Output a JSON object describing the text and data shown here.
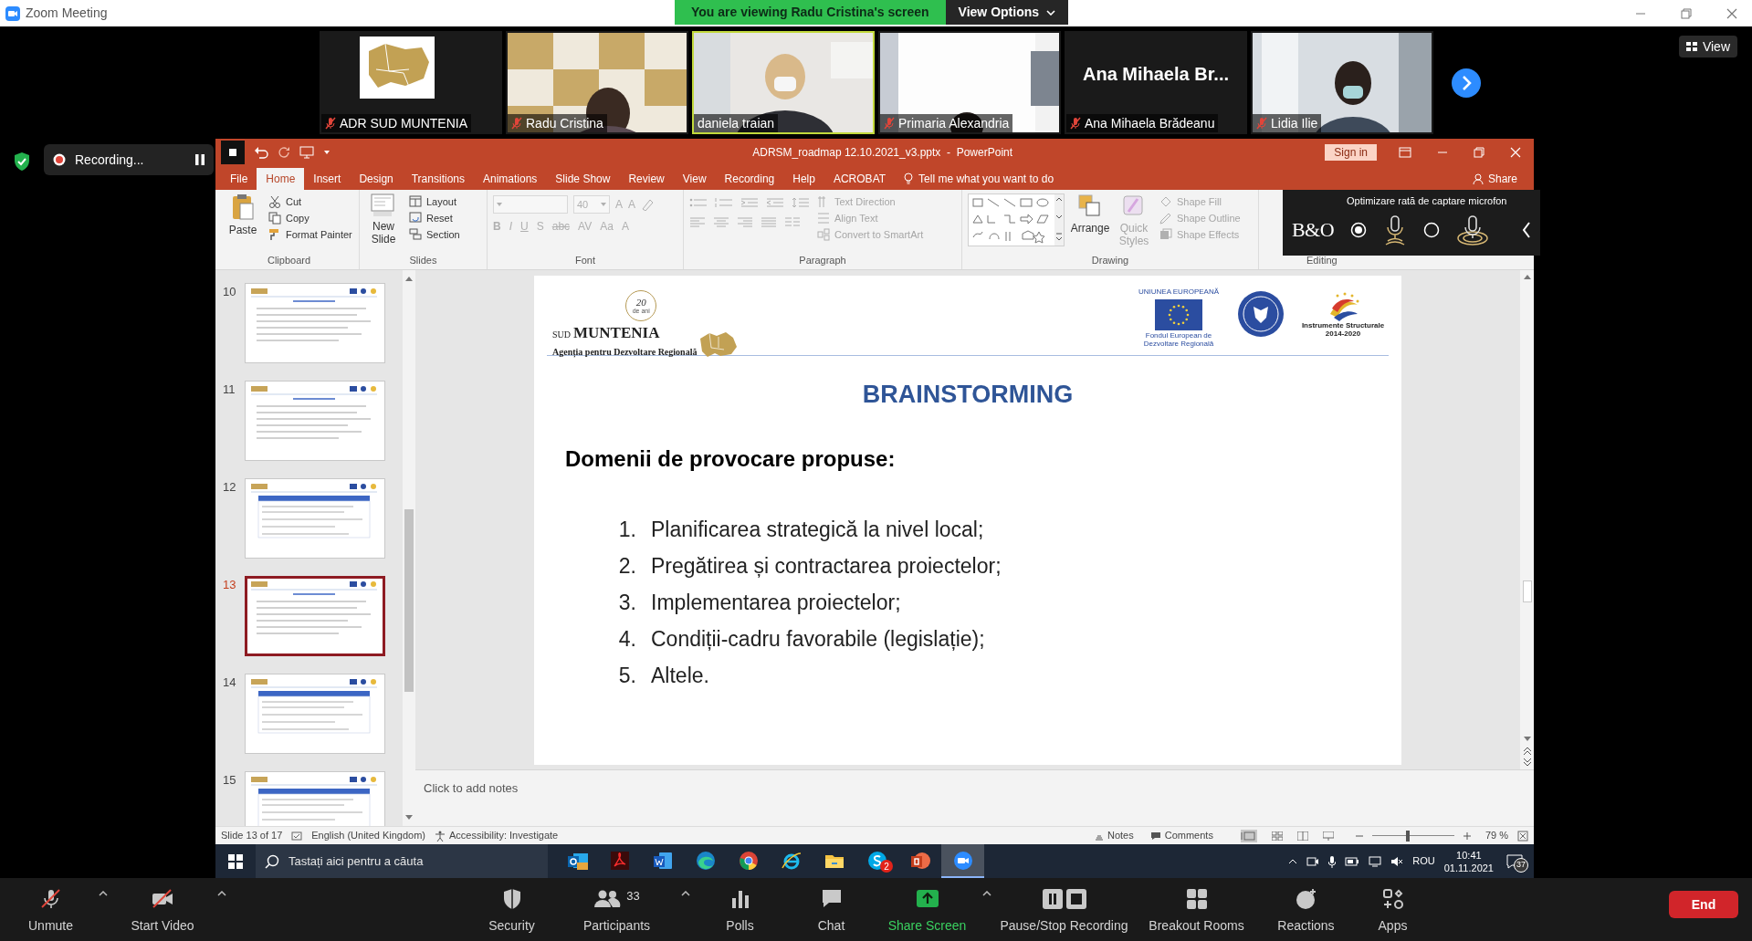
{
  "window": {
    "title": "Zoom Meeting"
  },
  "share_banner": {
    "text": "You are viewing Radu Cristina's screen",
    "menu": "View Options"
  },
  "view_button": "View",
  "participants": [
    {
      "name": "ADR SUD MUNTENIA",
      "kind": "logo",
      "muted": true,
      "speaking": false
    },
    {
      "name": "Radu Cristina",
      "kind": "video",
      "muted": true,
      "speaking": false
    },
    {
      "name": "daniela traian",
      "kind": "video",
      "muted": false,
      "speaking": true
    },
    {
      "name": "Primaria Alexandria",
      "kind": "video",
      "muted": true,
      "speaking": false
    },
    {
      "name": "Ana Mihaela Brădeanu",
      "kind": "name_card",
      "card_text": "Ana Mihaela Br...",
      "muted": true,
      "speaking": false
    },
    {
      "name": "Lidia Ilie",
      "kind": "video",
      "muted": true,
      "speaking": false
    }
  ],
  "recording": {
    "label": "Recording..."
  },
  "powerpoint": {
    "file_title": "ADRSM_roadmap 12.10.2021_v3.pptx  -  PowerPoint",
    "sign_in": "Sign in",
    "tabs": [
      {
        "label": "File",
        "selected": false
      },
      {
        "label": "Home",
        "selected": true
      },
      {
        "label": "Insert",
        "selected": false
      },
      {
        "label": "Design",
        "selected": false
      },
      {
        "label": "Transitions",
        "selected": false
      },
      {
        "label": "Animations",
        "selected": false
      },
      {
        "label": "Slide Show",
        "selected": false
      },
      {
        "label": "Review",
        "selected": false
      },
      {
        "label": "View",
        "selected": false
      },
      {
        "label": "Recording",
        "selected": false
      },
      {
        "label": "Help",
        "selected": false
      },
      {
        "label": "ACROBAT",
        "selected": false
      }
    ],
    "tell_me": "Tell me what you want to do",
    "share": "Share",
    "ribbon": [
      {
        "kind": "clipboard",
        "label": "Clipboard",
        "items": [
          {
            "kind": "large",
            "label": "Paste",
            "disabled": false
          },
          {
            "kind": "small",
            "label": "Cut",
            "disabled": false
          },
          {
            "kind": "small",
            "label": "Copy",
            "disabled": false
          },
          {
            "kind": "small",
            "label": "Format Painter",
            "disabled": false
          }
        ]
      },
      {
        "kind": "slides",
        "label": "Slides",
        "items": [
          {
            "kind": "large",
            "label": "New Slide",
            "disabled": false
          },
          {
            "kind": "small",
            "label": "Layout",
            "disabled": false
          },
          {
            "kind": "small",
            "label": "Reset",
            "disabled": false
          },
          {
            "kind": "small",
            "label": "Section",
            "disabled": false
          }
        ]
      },
      {
        "kind": "font",
        "label": "Font",
        "items": [
          {
            "kind": "combo",
            "disabled": true
          },
          {
            "kind": "combo",
            "value": "40",
            "disabled": true
          },
          {
            "kind": "glyph",
            "label": "A",
            "disabled": true
          },
          {
            "kind": "glyph",
            "label": "A",
            "disabled": true
          },
          {
            "kind": "glyph",
            "label": "B",
            "disabled": true
          },
          {
            "kind": "glyph",
            "label": "I",
            "disabled": true
          },
          {
            "kind": "glyph",
            "label": "U",
            "disabled": true
          },
          {
            "kind": "glyph",
            "label": "S",
            "disabled": true
          },
          {
            "kind": "glyph",
            "label": "abc",
            "disabled": true
          },
          {
            "kind": "glyph",
            "label": "AV",
            "disabled": true
          },
          {
            "kind": "glyph",
            "label": "Aa",
            "disabled": true
          },
          {
            "kind": "glyph",
            "label": "A",
            "disabled": true
          }
        ]
      },
      {
        "kind": "paragraph",
        "label": "Paragraph",
        "items": [
          {
            "kind": "small",
            "label": "Text Direction",
            "disabled": true
          },
          {
            "kind": "small",
            "label": "Align Text",
            "disabled": true
          },
          {
            "kind": "small",
            "label": "Convert to SmartArt",
            "disabled": true
          }
        ]
      },
      {
        "kind": "drawing",
        "label": "Drawing",
        "items": [
          {
            "kind": "large",
            "label": "Arrange",
            "disabled": false
          },
          {
            "kind": "large",
            "label": "Quick Styles",
            "disabled": true
          },
          {
            "kind": "small",
            "label": "Shape Fill",
            "disabled": true
          },
          {
            "kind": "small",
            "label": "Shape Outline",
            "disabled": true
          },
          {
            "kind": "small",
            "label": "Shape Effects",
            "disabled": true
          }
        ]
      },
      {
        "kind": "editing",
        "label": "Editing"
      }
    ],
    "overlay": {
      "text": "Optimizare rată de captare microfon",
      "logo": "B&O",
      "options": [
        {
          "selected": true
        },
        {
          "selected": false
        }
      ]
    },
    "thumbnails": [
      {
        "number": "10",
        "selected": false
      },
      {
        "number": "11",
        "selected": false
      },
      {
        "number": "12",
        "selected": false
      },
      {
        "number": "13",
        "selected": true
      },
      {
        "number": "14",
        "selected": false
      },
      {
        "number": "15",
        "selected": false
      }
    ],
    "slide": {
      "anniversary": "20",
      "anniversary_sub": "de ani",
      "name_prefix": "SUD",
      "name": "MUNTENIA",
      "agency": "Agenția pentru Dezvoltare Regională",
      "eu_top": "UNIUNEA EUROPEANĂ",
      "eu_bottom": "Fondul European de Dezvoltare Regională",
      "structural": "Instrumente Structurale 2014-2020",
      "title": "BRAINSTORMING",
      "subtitle": "Domenii de provocare propuse:",
      "items": [
        {
          "number": "1.",
          "text": "Planificarea strategică la nivel local;"
        },
        {
          "number": "2.",
          "text": "Pregătirea și contractarea proiectelor;"
        },
        {
          "number": "3.",
          "text": "Implementarea proiectelor;"
        },
        {
          "number": "4.",
          "text": "Condiții-cadru favorabile (legislație);"
        },
        {
          "number": "5.",
          "text": "Altele."
        }
      ]
    },
    "notes_placeholder": "Click to add notes",
    "status": {
      "slide": "Slide 13 of 17",
      "language": "English (United Kingdom)",
      "accessibility": "Accessibility: Investigate",
      "notes": "Notes",
      "comments": "Comments",
      "zoom": "79 %",
      "zoom_slider": {
        "level": 0.43
      }
    }
  },
  "taskbar": {
    "search_placeholder": "Tastați aici pentru a căuta",
    "apps": [
      {
        "kind": "outlook",
        "active": false
      },
      {
        "kind": "acrobat",
        "active": false
      },
      {
        "kind": "word",
        "active": false
      },
      {
        "kind": "edge",
        "active": false
      },
      {
        "kind": "chrome",
        "active": false
      },
      {
        "kind": "ie",
        "active": false
      },
      {
        "kind": "explorer",
        "active": false
      },
      {
        "kind": "skype",
        "active": false,
        "badge": "2"
      },
      {
        "kind": "powerpoint",
        "active": false
      },
      {
        "kind": "zoom",
        "active": true
      }
    ],
    "language": "ROU",
    "time": "10:41",
    "date": "01.11.2021",
    "notifications": "37"
  },
  "toolbar": {
    "audio_video": [
      {
        "label": "Unmute",
        "kind": "mic",
        "off": true,
        "caret": true
      },
      {
        "label": "Start Video",
        "kind": "camera",
        "off": true,
        "caret": true
      }
    ],
    "controls": [
      {
        "label": "Security",
        "kind": "shield",
        "caret": false
      },
      {
        "label": "Participants",
        "kind": "people",
        "count": "33",
        "caret": true
      },
      {
        "label": "Polls",
        "kind": "polls",
        "caret": false
      },
      {
        "label": "Chat",
        "kind": "chat",
        "caret": false
      },
      {
        "label": "Share Screen",
        "kind": "share",
        "caret": true
      },
      {
        "label": "Pause/Stop Recording",
        "kind": "recording",
        "caret": false
      },
      {
        "label": "Breakout Rooms",
        "kind": "breakout",
        "caret": false
      },
      {
        "label": "Reactions",
        "kind": "reactions",
        "caret": false
      },
      {
        "label": "Apps",
        "kind": "apps",
        "caret": false
      }
    ],
    "end_button": "End"
  }
}
